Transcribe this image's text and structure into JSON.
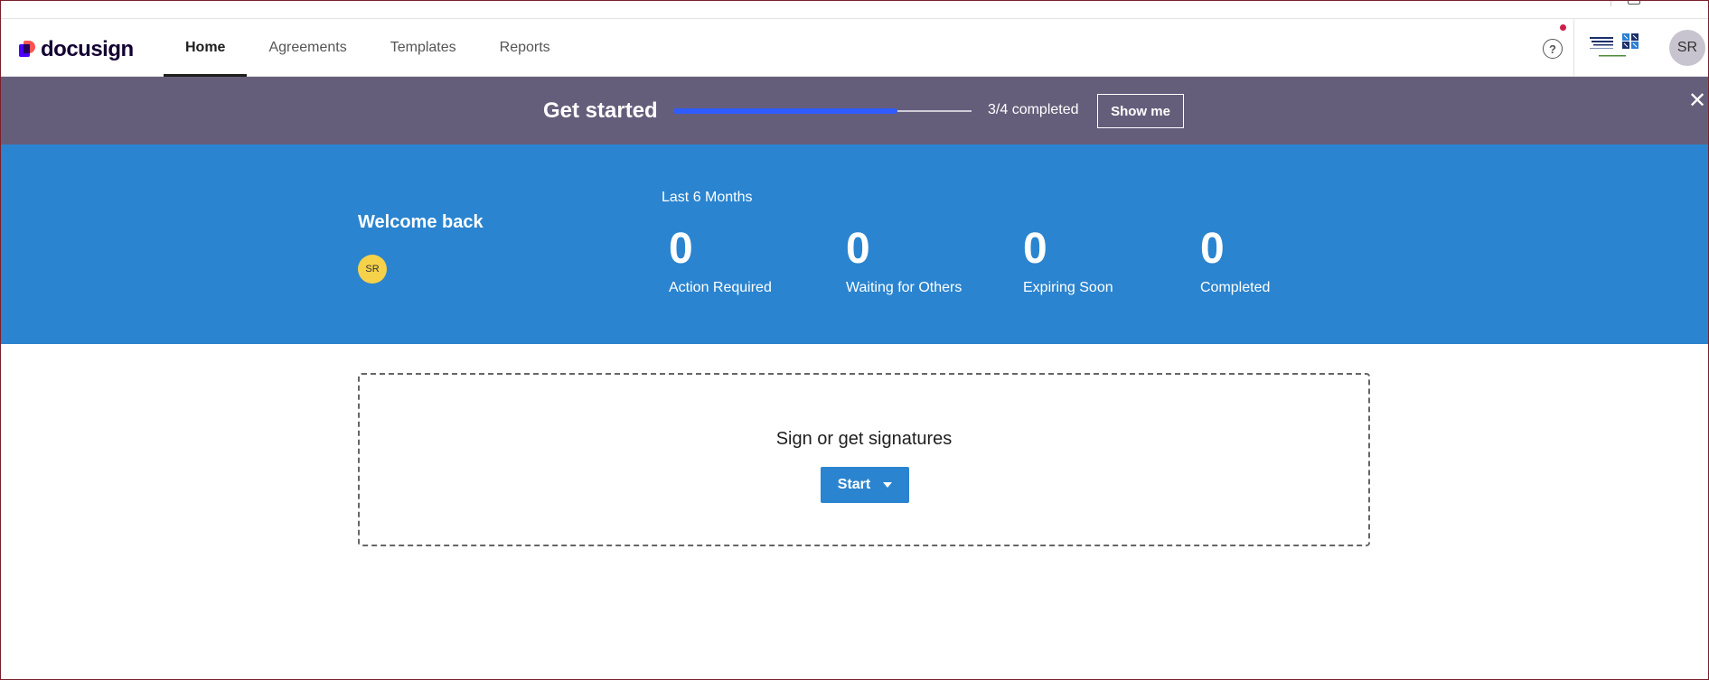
{
  "header": {
    "logo_text": "docusign",
    "nav": [
      {
        "label": "Home",
        "active": true
      },
      {
        "label": "Agreements",
        "active": false
      },
      {
        "label": "Templates",
        "active": false
      },
      {
        "label": "Reports",
        "active": false
      }
    ],
    "help_icon": "question-circle-icon",
    "user_initials": "SR"
  },
  "banner": {
    "title": "Get started",
    "progress_fraction": 0.75,
    "progress_text": "3/4 completed",
    "show_me_label": "Show me",
    "close_icon": "close-icon"
  },
  "welcome": {
    "title": "Welcome back",
    "initials": "SR",
    "period": "Last 6 Months",
    "stats": [
      {
        "value": "0",
        "label": "Action Required"
      },
      {
        "value": "0",
        "label": "Waiting for Others"
      },
      {
        "value": "0",
        "label": "Expiring Soon"
      },
      {
        "value": "0",
        "label": "Completed"
      }
    ]
  },
  "dropzone": {
    "title": "Sign or get signatures",
    "start_label": "Start"
  },
  "colors": {
    "banner_bg": "#655e7b",
    "welcome_bg": "#2b84cf",
    "progress": "#2f5bff",
    "notification": "#cc1f4a"
  }
}
